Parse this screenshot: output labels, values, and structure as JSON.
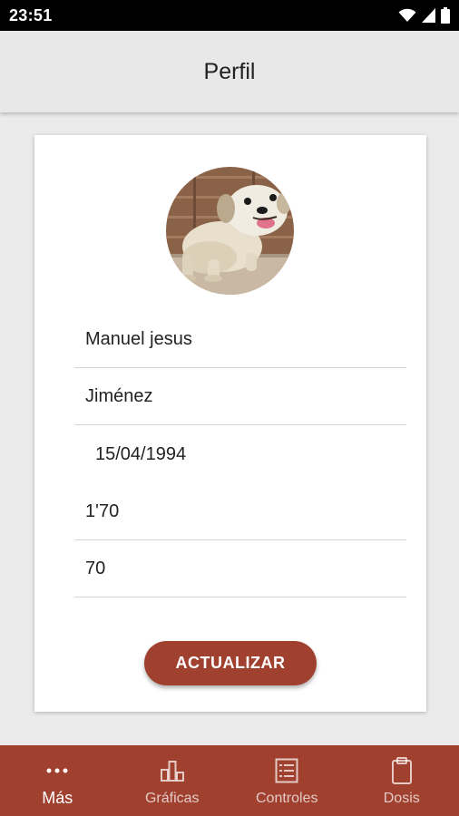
{
  "status_bar": {
    "time": "23:51",
    "icons": [
      "wifi-icon",
      "signal-icon",
      "battery-icon"
    ]
  },
  "app_bar": {
    "title": "Perfil"
  },
  "profile": {
    "avatar": "dog-photo-avatar",
    "first_name": "Manuel jesus",
    "last_name": "Jiménez",
    "birth_date": "15/04/1994",
    "height": "1'70",
    "weight": "70",
    "update_label": "ACTUALIZAR"
  },
  "bottom_nav": {
    "items": [
      {
        "label": "Más",
        "icon": "more-dots-icon",
        "active": true
      },
      {
        "label": "Gráficas",
        "icon": "bar-chart-icon",
        "active": false
      },
      {
        "label": "Controles",
        "icon": "list-icon",
        "active": false
      },
      {
        "label": "Dosis",
        "icon": "clipboard-icon",
        "active": false
      }
    ]
  },
  "colors": {
    "accent": "#a0402f",
    "background": "#ebebeb",
    "card": "#ffffff",
    "app_bar": "#e8e8e8"
  }
}
